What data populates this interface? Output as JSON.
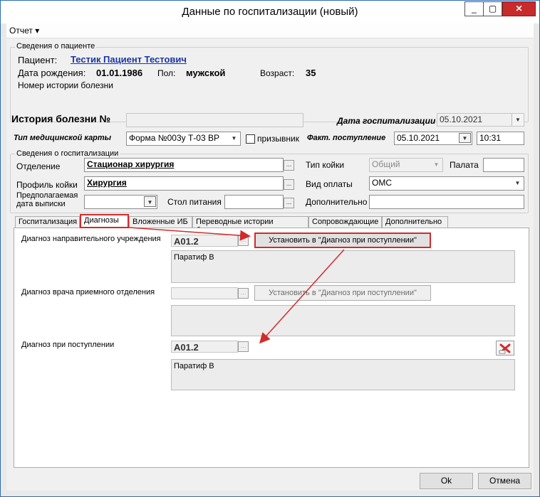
{
  "window": {
    "title": "Данные по госпитализации (новый)",
    "minimize": "_",
    "maximize": "▢",
    "close": "✕"
  },
  "menu": {
    "report": "Отчет ▾"
  },
  "patient": {
    "legend": "Сведения о пациенте",
    "patient_label": "Пациент:",
    "patient_name": "Тестик Пациент Тестович",
    "birth_label": "Дата рождения:",
    "birth_value": "01.01.1986",
    "sex_label": "Пол:",
    "sex_value": "мужской",
    "age_label": "Возраст:",
    "age_value": "35",
    "history_label": "Номер истории болезни"
  },
  "header": {
    "history_no_label": "История болезни №",
    "hosp_date_label": "Дата госпитализации",
    "hosp_date_value": "05.10.2021",
    "card_type_label": "Тип медицинской карты",
    "card_type_value": "Форма №003у Т-03 ВР",
    "conscript_label": "призывник",
    "fact_label": "Факт. поступление",
    "fact_date": "05.10.2021",
    "fact_time": "10:31"
  },
  "hosp": {
    "legend": "Сведения о госпитализации",
    "dept_label": "Отделение",
    "dept_value": "Стационар  хирургия",
    "bed_type_label": "Тип койки",
    "bed_type_value": "Общий",
    "ward_label": "Палата",
    "profile_label": "Профиль койки",
    "profile_value": "Хирургия",
    "payment_label": "Вид оплаты",
    "payment_value": "ОМС",
    "discharge_label_1": "Предполагаемая",
    "discharge_label_2": "дата выписки",
    "diet_label": "Стол питания",
    "extra_label": "Дополнительно"
  },
  "tabs": [
    {
      "label": "Госпитализация"
    },
    {
      "label": "Диагнозы"
    },
    {
      "label": "Вложенные ИБ"
    },
    {
      "label": "Переводные истории болезни"
    },
    {
      "label": "Сопровождающие"
    },
    {
      "label": "Дополнительно"
    }
  ],
  "diagnoses": {
    "referral_label": "Диагноз направительного учреждения",
    "referral_code": "A01.2",
    "referral_text": "Паратиф В",
    "set_button": "Установить в \"Диагноз при поступлении\"",
    "reception_label": "Диагноз врача приемного отделения",
    "reception_code": "",
    "reception_text": "",
    "admission_label": "Диагноз при поступлении",
    "admission_code": "A01.2",
    "admission_text": "Паратиф В"
  },
  "footer": {
    "ok": "Ok",
    "cancel": "Отмена"
  },
  "colors": {
    "highlight": "#d12b2b",
    "link": "#1a35a5"
  }
}
